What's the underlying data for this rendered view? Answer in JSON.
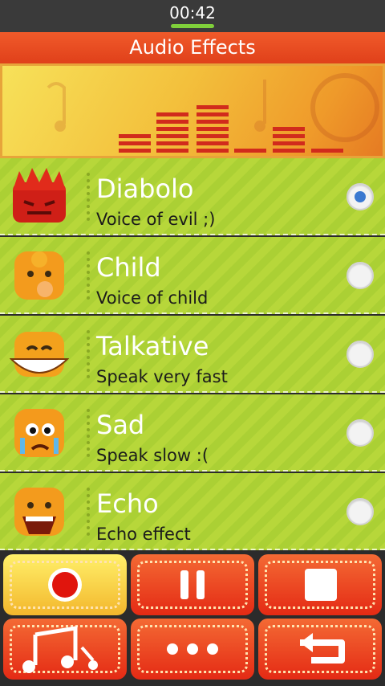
{
  "status": {
    "time": "00:42"
  },
  "header": {
    "title": "Audio Effects"
  },
  "effects": [
    {
      "name": "Diabolo",
      "desc": "Voice of evil ;)",
      "selected": true
    },
    {
      "name": "Child",
      "desc": "Voice of child",
      "selected": false
    },
    {
      "name": "Talkative",
      "desc": "Speak very fast",
      "selected": false
    },
    {
      "name": "Sad",
      "desc": "Speak slow :(",
      "selected": false
    },
    {
      "name": "Echo",
      "desc": "Echo effect",
      "selected": false
    }
  ],
  "controls": [
    {
      "icon": "record-icon"
    },
    {
      "icon": "pause-icon"
    },
    {
      "icon": "stop-icon"
    },
    {
      "icon": "music-notes-icon"
    },
    {
      "icon": "more-icon"
    },
    {
      "icon": "back-icon"
    }
  ],
  "colors": {
    "accent": "#e84c24",
    "list": "#b7d73a",
    "selected_radio": "#3b79d0"
  }
}
